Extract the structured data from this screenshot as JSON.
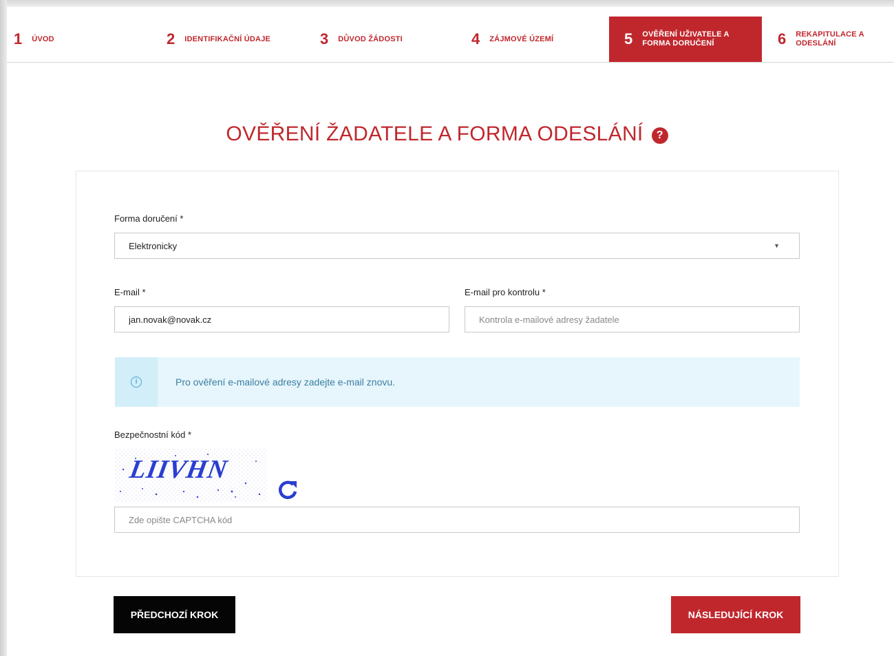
{
  "steps": [
    {
      "num": "1",
      "label": "ÚVOD"
    },
    {
      "num": "2",
      "label": "IDENTIFIKAČNÍ ÚDAJE"
    },
    {
      "num": "3",
      "label": "DŮVOD ŽÁDOSTI"
    },
    {
      "num": "4",
      "label": "ZÁJMOVÉ ÚZEMÍ"
    },
    {
      "num": "5",
      "label": "OVĚŘENÍ UŽIVATELE A FORMA DORUČENÍ"
    },
    {
      "num": "6",
      "label": "REKAPITULACE A ODESLÁNÍ"
    }
  ],
  "active_step": "5",
  "page": {
    "title": "OVĚŘENÍ ŽADATELE A FORMA ODESLÁNÍ",
    "help_icon": "?"
  },
  "form": {
    "delivery_label": "Forma doručení *",
    "delivery_value": "Elektronicky",
    "email_label": "E-mail *",
    "email_value": "jan.novak@novak.cz",
    "email_confirm_label": "E-mail pro kontrolu *",
    "email_confirm_placeholder": "Kontrola e-mailové adresy žadatele",
    "info_text": "Pro ověření e-mailové adresy zadejte e-mail znovu.",
    "captcha_label": "Bezpečnostní kód *",
    "captcha_code": "LIIVHN",
    "captcha_placeholder": "Zde opište CAPTCHA kód"
  },
  "buttons": {
    "prev": "PŘEDCHOZÍ KROK",
    "next": "NÁSLEDUJÍCÍ KROK"
  },
  "colors": {
    "accent": "#c0272d",
    "info_bg": "#e6f6fc",
    "info_text": "#3b7da1",
    "captcha": "#2a3fd0"
  },
  "icons": {
    "help": "question-circle-icon",
    "info": "info-circle-icon",
    "refresh": "refresh-icon",
    "caret": "caret-down-icon"
  }
}
